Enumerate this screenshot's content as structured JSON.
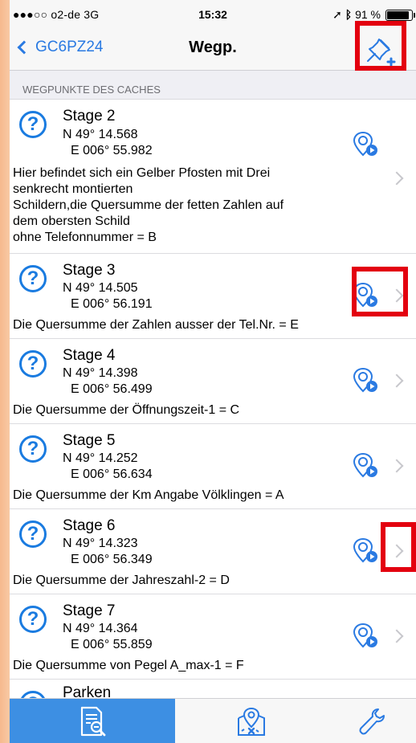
{
  "status": {
    "carrier": "●●●○○ o2-de  3G",
    "time": "15:32",
    "battery_text": "91 %"
  },
  "nav": {
    "back_label": "GC6PZ24",
    "title": "Wegp."
  },
  "section_header": "WEGPUNKTE DES CACHES",
  "waypoints": [
    {
      "name": "Stage 2",
      "lat": "N 49° 14.568",
      "lon": "E 006° 55.982",
      "description": "Hier befindet sich ein Gelber Pfosten mit Drei\nsenkrecht montierten\nSchildern,die Quersumme der fetten Zahlen auf\ndem obersten Schild\nohne Telefonnummer = B"
    },
    {
      "name": "Stage 3",
      "lat": "N 49° 14.505",
      "lon": "E 006° 56.191",
      "description": "Die Quersumme der Zahlen ausser der Tel.Nr. = E"
    },
    {
      "name": "Stage 4",
      "lat": "N 49° 14.398",
      "lon": "E 006° 56.499",
      "description": "Die Quersumme der Öffnungszeit-1 = C"
    },
    {
      "name": "Stage 5",
      "lat": "N 49° 14.252",
      "lon": "E 006° 56.634",
      "description": "Die Quersumme der Km Angabe Völklingen = A"
    },
    {
      "name": "Stage 6",
      "lat": "N 49° 14.323",
      "lon": "E 006° 56.349",
      "description": "Die Quersumme der Jahreszahl-2 = D"
    },
    {
      "name": "Stage 7",
      "lat": "N 49° 14.364",
      "lon": "E 006° 55.859",
      "description": "Die Quersumme von Pegel A_max-1 = F"
    },
    {
      "name": "Parken"
    }
  ],
  "icons": {
    "question": "?",
    "accent": "#1a7be0",
    "highlight": "#e3000f"
  }
}
